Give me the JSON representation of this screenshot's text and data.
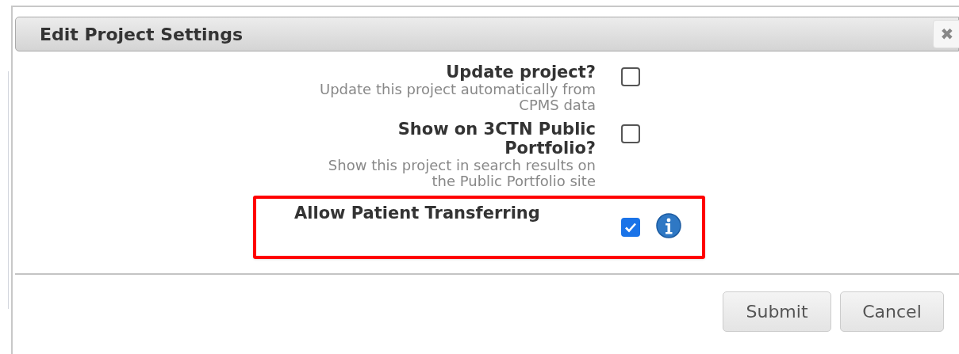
{
  "dialog": {
    "title": "Edit Project Settings",
    "close": "✖"
  },
  "settings": [
    {
      "kind": "plain",
      "label": "Update project?",
      "description": "Update this project automatically from CPMS data",
      "checked": false,
      "highlighted": false
    },
    {
      "kind": "plain",
      "label": "Show on 3CTN Public Portfolio?",
      "description": "Show this project in search results on the Public Portfolio site",
      "checked": false,
      "highlighted": false
    },
    {
      "kind": "info",
      "label": "Allow Patient Transferring",
      "checked": true,
      "highlighted": true
    }
  ],
  "buttons": [
    "Submit",
    "Cancel"
  ]
}
